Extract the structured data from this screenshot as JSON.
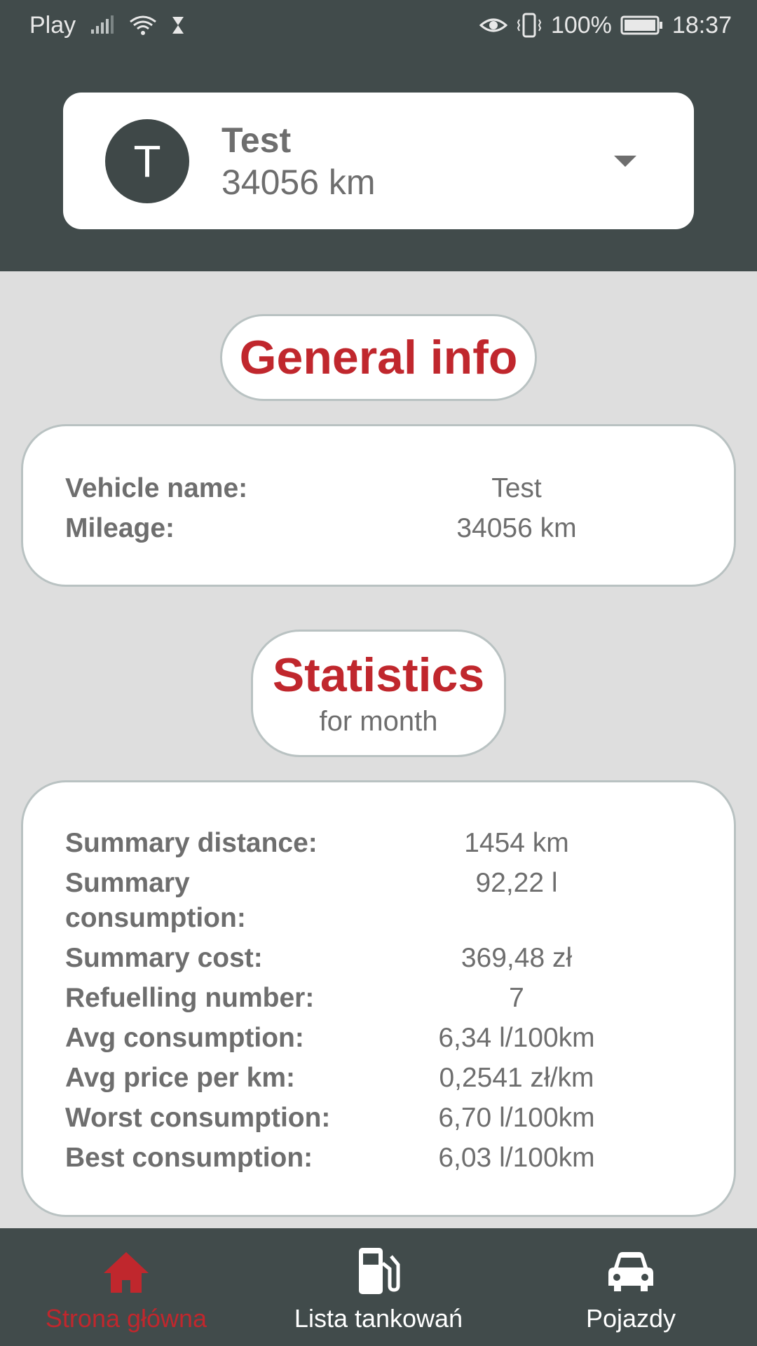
{
  "status_bar": {
    "carrier": "Play",
    "battery": "100%",
    "time": "18:37"
  },
  "vehicle_selector": {
    "avatar_letter": "T",
    "name": "Test",
    "mileage": "34056 km"
  },
  "general_info": {
    "title": "General info",
    "rows": [
      {
        "label": "Vehicle name:",
        "value": "Test"
      },
      {
        "label": "Mileage:",
        "value": "34056 km"
      }
    ]
  },
  "statistics": {
    "title": "Statistics",
    "subtitle": "for month",
    "rows": [
      {
        "label": "Summary distance:",
        "value": "1454 km"
      },
      {
        "label": "Summary consumption:",
        "value": "92,22 l"
      },
      {
        "label": "Summary cost:",
        "value": "369,48 zł"
      },
      {
        "label": "Refuelling number:",
        "value": "7"
      },
      {
        "label": "Avg consumption:",
        "value": "6,34 l/100km"
      },
      {
        "label": "Avg price per km:",
        "value": "0,2541 zł/km"
      },
      {
        "label": "Worst consumption:",
        "value": "6,70 l/100km"
      },
      {
        "label": "Best consumption:",
        "value": "6,03 l/100km"
      }
    ]
  },
  "bottom_nav": {
    "items": [
      {
        "label": "Strona główna",
        "icon": "home-icon",
        "active": true
      },
      {
        "label": "Lista tankowań",
        "icon": "fuel-pump-icon",
        "active": false
      },
      {
        "label": "Pojazdy",
        "icon": "car-icon",
        "active": false
      }
    ]
  },
  "colors": {
    "accent": "#c0272d",
    "header_bg": "#414b4b",
    "page_bg": "#dedede"
  }
}
